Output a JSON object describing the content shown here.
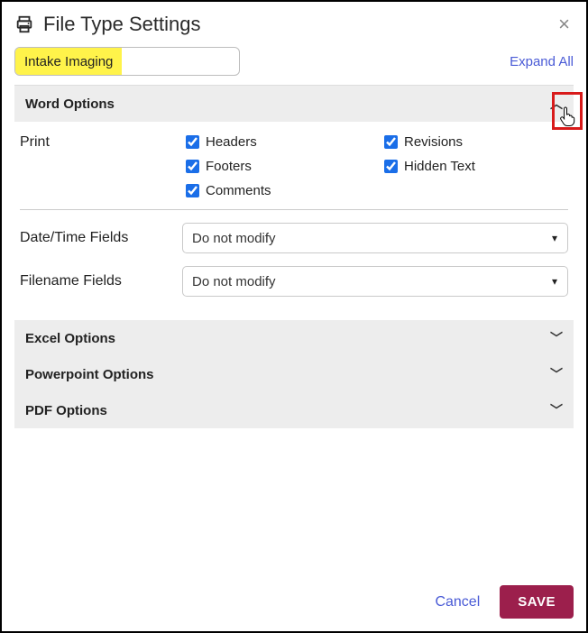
{
  "header": {
    "title": "File Type Settings"
  },
  "context_label": "Intake Imaging",
  "expand_all_label": "Expand All",
  "sections": {
    "word": {
      "title": "Word Options"
    },
    "excel": {
      "title": "Excel Options"
    },
    "powerpoint": {
      "title": "Powerpoint Options"
    },
    "pdf": {
      "title": "PDF Options"
    }
  },
  "word_panel": {
    "print_label": "Print",
    "checks": {
      "headers": "Headers",
      "footers": "Footers",
      "comments": "Comments",
      "revisions": "Revisions",
      "hidden_text": "Hidden Text"
    },
    "date_time_label": "Date/Time Fields",
    "filename_label": "Filename Fields",
    "select_value": "Do not modify"
  },
  "footer": {
    "cancel": "Cancel",
    "save": "SAVE"
  }
}
